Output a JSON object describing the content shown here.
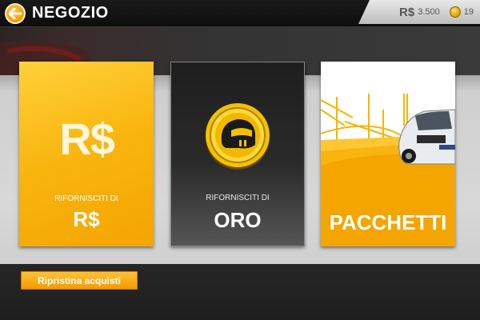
{
  "header": {
    "title": "NEGOZIO",
    "back_icon": "arrow-left-icon"
  },
  "currency": {
    "rs_symbol": "R$",
    "rs_value": "3.500",
    "gold_icon": "gold-coin-icon",
    "gold_value": "19"
  },
  "cards": {
    "rs": {
      "icon_text": "R$",
      "subtitle": "RIFORNISCITI DI",
      "title": "R$"
    },
    "gold": {
      "icon": "helmet-coin-icon",
      "subtitle": "RIFORNISCITI DI",
      "title": "ORO"
    },
    "packs": {
      "title": "PACCHETTI"
    }
  },
  "restore_button": {
    "label": "Ripristina acquisti"
  },
  "colors": {
    "accent": "#f9b40e",
    "dark": "#1e1e1e"
  }
}
